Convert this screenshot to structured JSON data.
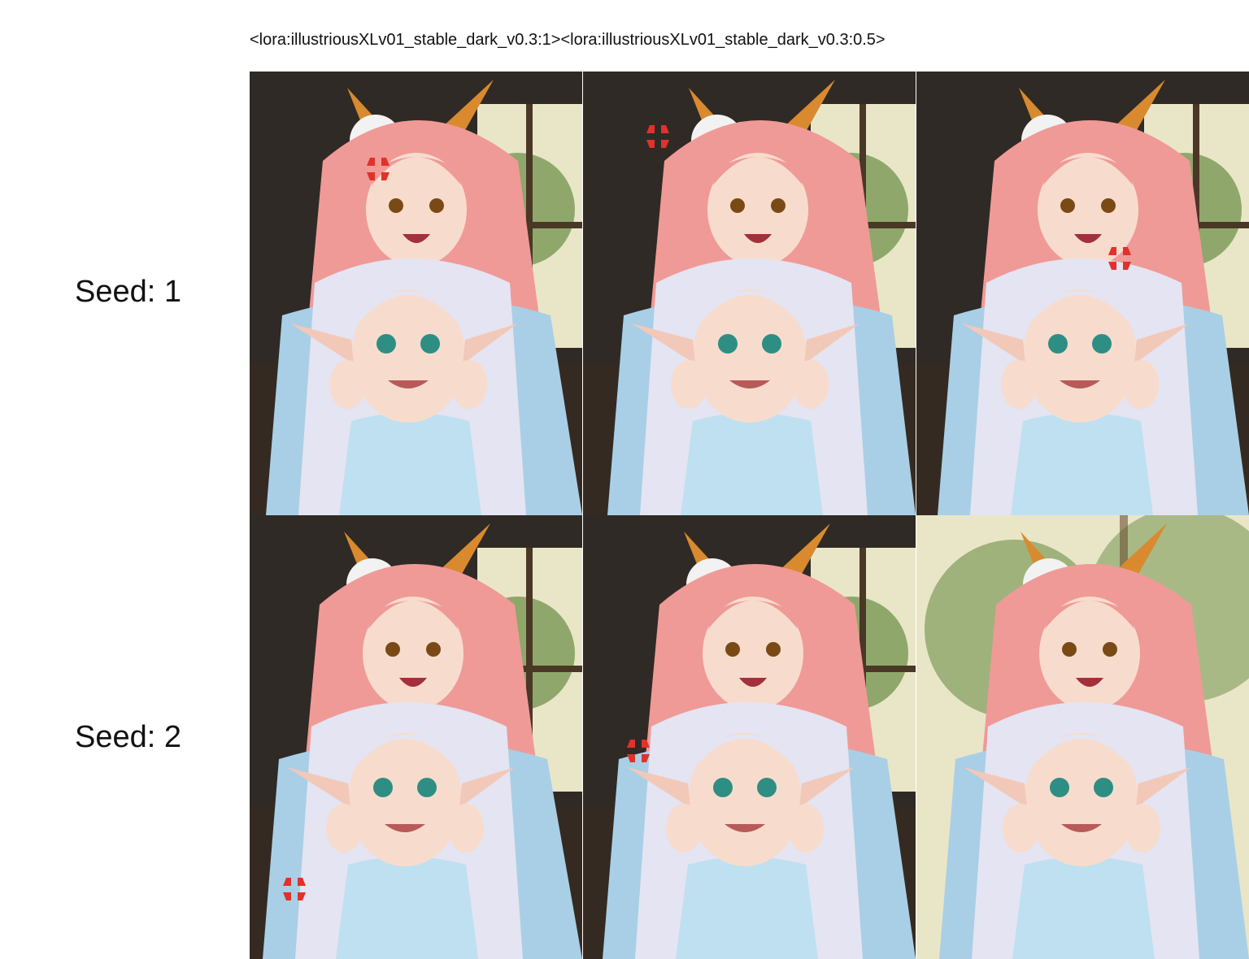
{
  "header": {
    "columns_label": "<lora:illustriousXLv01_stable_dark_v0.3:1><lora:illustriousXLv01_stable_dark_v0.3:0.5>"
  },
  "rows": [
    {
      "label": "Seed: 1"
    },
    {
      "label": "Seed: 2"
    }
  ],
  "images": [
    {
      "row": 0,
      "col": 0,
      "subject": "illustration"
    },
    {
      "row": 0,
      "col": 1,
      "subject": "illustration"
    },
    {
      "row": 0,
      "col": 2,
      "subject": "illustration"
    },
    {
      "row": 1,
      "col": 0,
      "subject": "illustration"
    },
    {
      "row": 1,
      "col": 1,
      "subject": "illustration"
    },
    {
      "row": 1,
      "col": 2,
      "subject": "illustration"
    }
  ],
  "colors": {
    "background": "#ffffff",
    "room_dark": "#2f2a25",
    "window_light": "#e9e6c8",
    "foliage": "#7f9b5a",
    "pink_hair": "#ef9a97",
    "silver_hair": "#e4e4f2",
    "pajama_blue": "#a9cfe6",
    "skin": "#f7dccd",
    "ear_orange": "#d98a2e",
    "anger_red": "#e0322b"
  }
}
